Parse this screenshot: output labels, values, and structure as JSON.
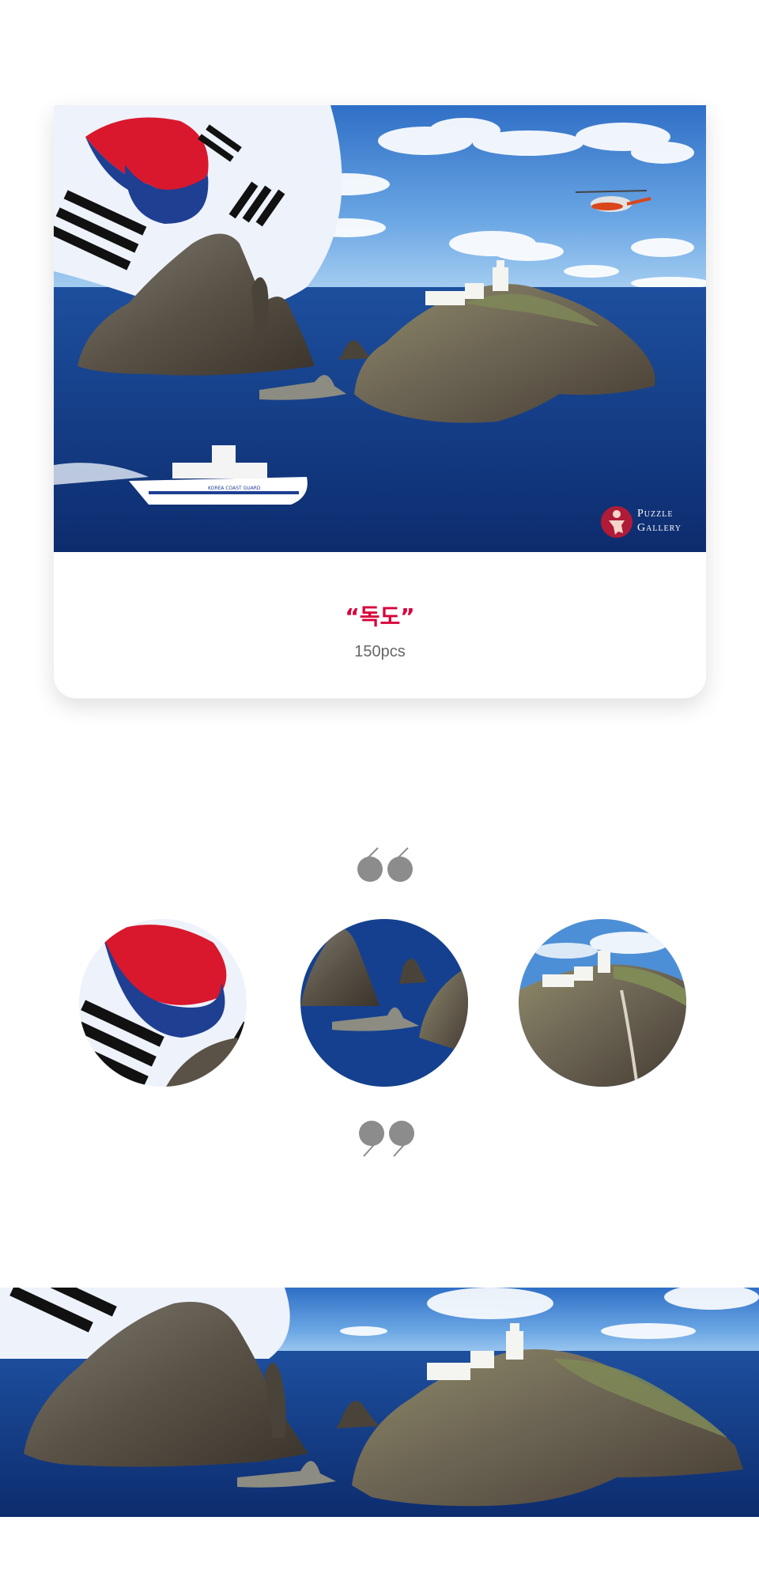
{
  "product": {
    "title": "“독도”",
    "pieces": "150pcs"
  },
  "brand": {
    "line1": "Puzzle",
    "line2": "Gallery",
    "icon": "puzzle-figure-icon"
  },
  "ship": {
    "hull_text": "KOREA COAST GUARD"
  },
  "quotes": {
    "open_icon": "open-quote-icon",
    "close_icon": "close-quote-icon"
  },
  "colors": {
    "accent": "#d8003a",
    "sea": "#123a86",
    "sky": "#4d8fd6",
    "taegeuk_red": "#d9182d",
    "taegeuk_blue": "#1f3f92",
    "quote_gray": "#8c8c8c"
  }
}
